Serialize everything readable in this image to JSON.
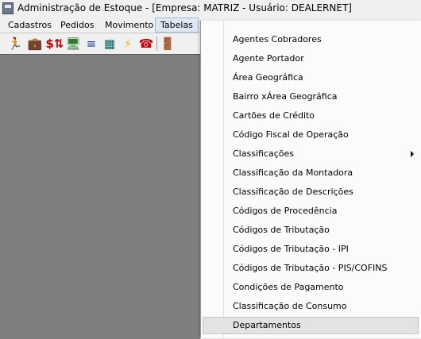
{
  "window": {
    "title": "Administração de Estoque - [Empresa: MATRIZ - Usuário: DEALERNET]"
  },
  "menubar": {
    "items": [
      {
        "label": "Cadastros"
      },
      {
        "label": "Pedidos"
      },
      {
        "label": "Movimento"
      },
      {
        "label": "Tabelas"
      }
    ],
    "active": "Tabelas"
  },
  "toolbar": {
    "buttons": [
      {
        "icon": "running-man-icon",
        "color": "#1a1a1a"
      },
      {
        "icon": "briefcase-icon",
        "color": "#d8a000"
      },
      {
        "icon": "dollar-swap-icon",
        "color": "#c00000"
      },
      {
        "icon": "monitor-icon",
        "color": "#2a7a2a"
      },
      {
        "icon": "list-icon",
        "color": "#1a3aa0"
      },
      {
        "icon": "calculator-icon",
        "color": "#006060"
      },
      {
        "icon": "lightning-icon",
        "color": "#e0c000"
      },
      {
        "icon": "telephone-icon",
        "color": "#c00000"
      },
      {
        "icon": "exit-door-icon",
        "color": "#2a8a2a"
      }
    ]
  },
  "dropdown": {
    "items": [
      {
        "label": "Agentes Cobradores"
      },
      {
        "label": "Agente Portador"
      },
      {
        "label": "Área Geográfica"
      },
      {
        "label": "Bairro xÁrea Geográfica"
      },
      {
        "label": "Cartões de Crédito"
      },
      {
        "label": "Código Fiscal de Operação"
      },
      {
        "label": "Classificações",
        "submenu": true
      },
      {
        "label": "Classificação da Montadora"
      },
      {
        "label": "Classificação de Descrições"
      },
      {
        "label": "Códigos de Procedência"
      },
      {
        "label": "Códigos de Tributação"
      },
      {
        "label": "Códigos de Tributação - IPI"
      },
      {
        "label": "Códigos de Tributação - PIS/COFINS"
      },
      {
        "label": "Condições de Pagamento"
      },
      {
        "label": "Classificação de Consumo"
      },
      {
        "label": "Departamentos",
        "highlighted": true
      }
    ]
  }
}
